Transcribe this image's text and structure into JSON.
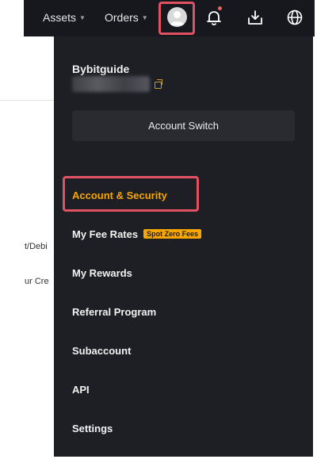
{
  "topbar": {
    "assets_label": "Assets",
    "orders_label": "Orders"
  },
  "background": {
    "partial_text_1": "t/Debi",
    "partial_text_2": "ur Cre"
  },
  "dropdown": {
    "username": "Bybitguide",
    "account_switch_label": "Account Switch",
    "items": [
      {
        "label": "Account & Security"
      },
      {
        "label": "My Fee Rates",
        "badge": "Spot Zero Fees"
      },
      {
        "label": "My Rewards"
      },
      {
        "label": "Referral Program"
      },
      {
        "label": "Subaccount"
      },
      {
        "label": "API"
      },
      {
        "label": "Settings"
      }
    ]
  },
  "colors": {
    "accent": "#f7a600",
    "highlight": "#e05263",
    "menu_bg": "#1e1f24",
    "topbar_bg": "#17181e"
  },
  "icons": [
    "user-avatar-icon",
    "bell-icon",
    "download-icon",
    "globe-icon",
    "copy-icon"
  ]
}
